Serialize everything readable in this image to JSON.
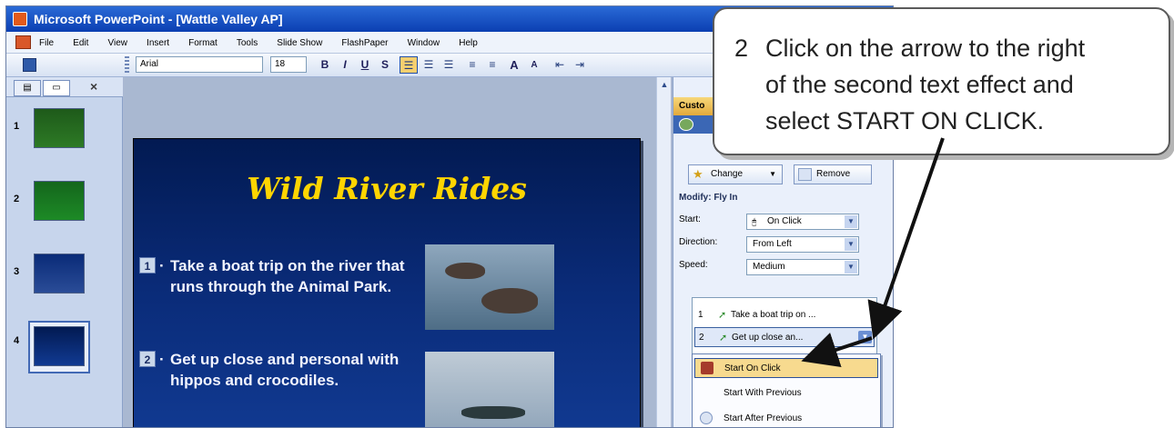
{
  "window": {
    "title": "Microsoft PowerPoint - [Wattle Valley AP]"
  },
  "menu": [
    "File",
    "Edit",
    "View",
    "Insert",
    "Format",
    "Tools",
    "Slide Show",
    "FlashPaper",
    "Window",
    "Help"
  ],
  "toolbar": {
    "font": "Arial",
    "size": "18",
    "bold": "B",
    "italic": "I",
    "underline": "U",
    "shadow": "S",
    "grow": "A",
    "shrink": "A"
  },
  "slides_panel": {
    "numbers": [
      "1",
      "2",
      "3",
      "4"
    ],
    "close": "×"
  },
  "slide": {
    "title": "Wild River Rides",
    "bullet1_tag": "1",
    "bullet1": "Take a boat trip on the river that runs through the Animal Park.",
    "bullet2_tag": "2",
    "bullet2": "Get up close and personal with hippos and crocodiles."
  },
  "task_pane": {
    "header": "Custo",
    "change_label": "Change",
    "remove_label": "Remove",
    "modify": "Modify: Fly In",
    "start_label": "Start:",
    "start_value": "On Click",
    "direction_label": "Direction:",
    "direction_value": "From Left",
    "speed_label": "Speed:",
    "speed_value": "Medium",
    "list": [
      {
        "num": "1",
        "text": "Take a boat trip on ..."
      },
      {
        "num": "2",
        "text": "Get up close an..."
      }
    ],
    "menu": [
      "Start On Click",
      "Start With Previous",
      "Start After Previous"
    ]
  },
  "callout": {
    "number": "2",
    "lines": [
      "Click on the arrow to the right",
      "of the second text effect and",
      "select START ON CLICK."
    ]
  },
  "colors": {
    "title_bar": "#0b3fb2",
    "slide_title": "#ffd500",
    "highlight": "#f7da8f",
    "slide_bg": "#0a2b78"
  }
}
